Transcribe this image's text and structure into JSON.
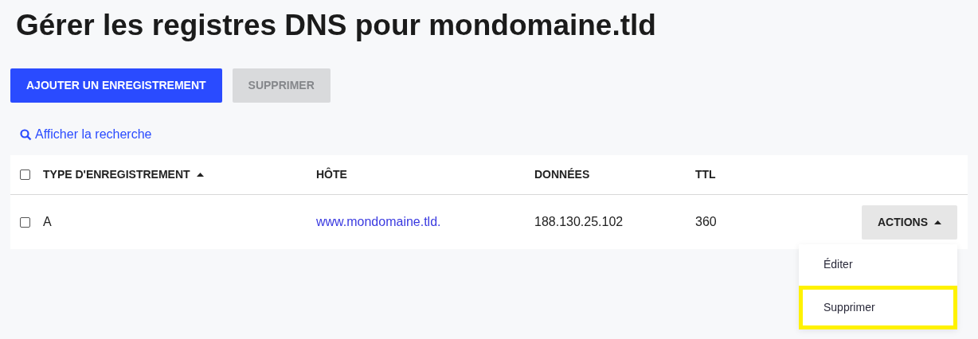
{
  "title": "Gérer les registres DNS pour mondomaine.tld",
  "buttons": [
    {
      "label": "AJOUTER UN ENREGISTREMENT",
      "disabled": false
    },
    {
      "label": "SUPPRIMER",
      "disabled": true
    }
  ],
  "search_link": "Afficher la recherche",
  "table": {
    "select_all_checked": false,
    "columns": [
      {
        "label": "TYPE D'ENREGISTREMENT",
        "sorted": true
      },
      {
        "label": "HÔTE",
        "sorted": false
      },
      {
        "label": "DONNÉES",
        "sorted": false
      },
      {
        "label": "TTL",
        "sorted": false
      }
    ],
    "rows": [
      {
        "checked": false,
        "type": "A",
        "host": "www.mondomaine.tld.",
        "data": "188.130.25.102",
        "ttl": "360",
        "actions": {
          "label": "ACTIONS",
          "expanded": true,
          "menu": [
            {
              "label": "Éditer",
              "highlighted": false
            },
            {
              "label": "Supprimer",
              "highlighted": true
            }
          ]
        }
      }
    ]
  }
}
